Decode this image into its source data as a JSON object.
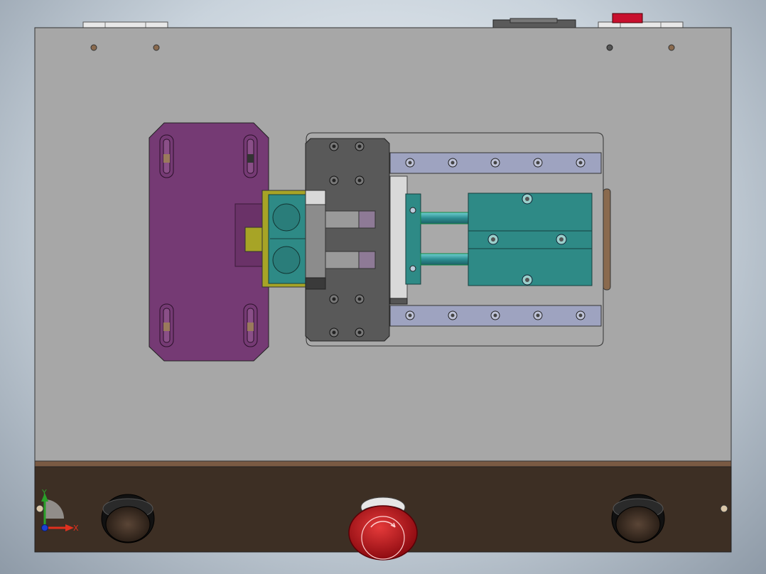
{
  "view": {
    "background": "#c9d3dc",
    "colors": {
      "base_plate": "#a7a7a7",
      "front_panel": "#3d2f24",
      "front_panel_edge": "#7a5a43",
      "purple_plate": "#753a74",
      "carriage": "#595959",
      "teal": "#2e8a86",
      "rail": "#9ea3c0",
      "yellow_block": "#a7a426",
      "estop": "#c1121c",
      "indicator": "#c8102e"
    }
  },
  "triad": {
    "x_label": "X",
    "y_label": "Y",
    "x_color": "#e0301e",
    "y_color": "#2aa02a",
    "z_color": "#1c3fd0"
  }
}
